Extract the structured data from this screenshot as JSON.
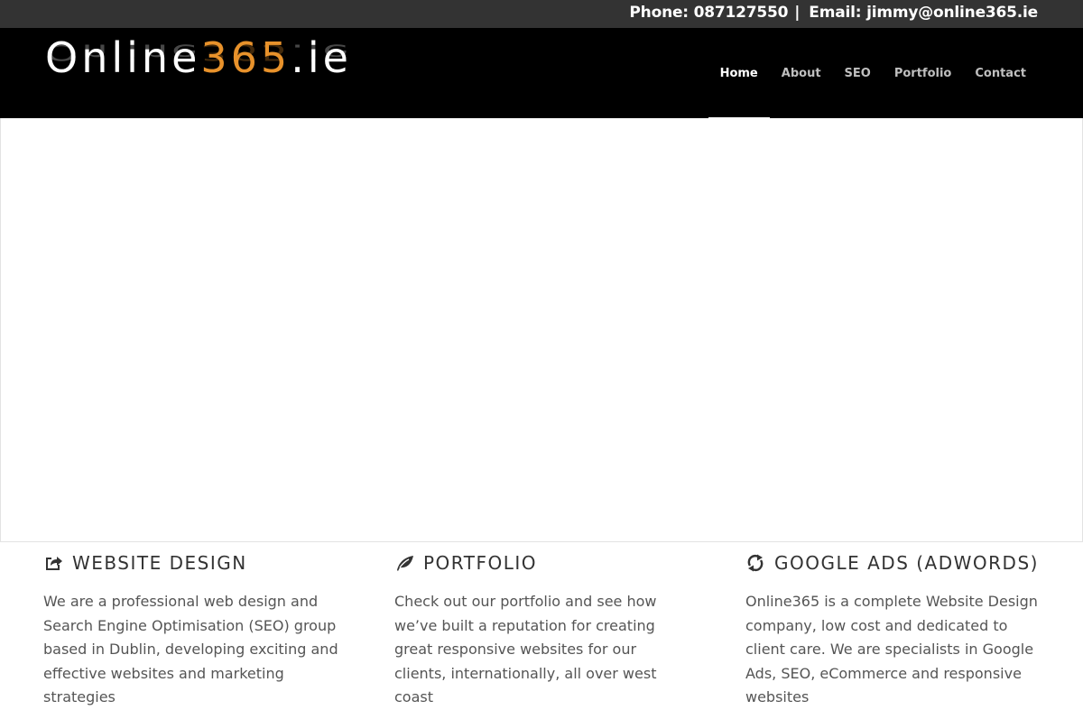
{
  "topbar": {
    "phone": "Phone: 087127550",
    "separator": "|",
    "email": "Email: jimmy@online365.ie"
  },
  "logo": {
    "part1": "Online",
    "part2": "365",
    "part3": ".ie",
    "accent_color": "#e8922b"
  },
  "nav": {
    "items": [
      {
        "label": "Home"
      },
      {
        "label": "About"
      },
      {
        "label": "SEO"
      },
      {
        "label": "Portfolio"
      },
      {
        "label": "Contact"
      }
    ]
  },
  "features": [
    {
      "icon": "share-icon",
      "title": "WEBSITE DESIGN",
      "text": "We are a professional web design and Search Engine Optimisation (SEO) group based in Dublin, developing exciting and effective websites and marketing strategies"
    },
    {
      "icon": "leaf-icon",
      "title": "PORTFOLIO",
      "text": "Check out our portfolio and see how we’ve built a reputation for creating great responsive websites for our clients, internationally, all over west coast"
    },
    {
      "icon": "refresh-icon",
      "title": "GOOGLE ADS (ADWORDS)",
      "text": "Online365 is a complete Website Design company, low cost and dedicated to client care. We are specialists in Google Ads, SEO, eCommerce and responsive websites"
    }
  ]
}
